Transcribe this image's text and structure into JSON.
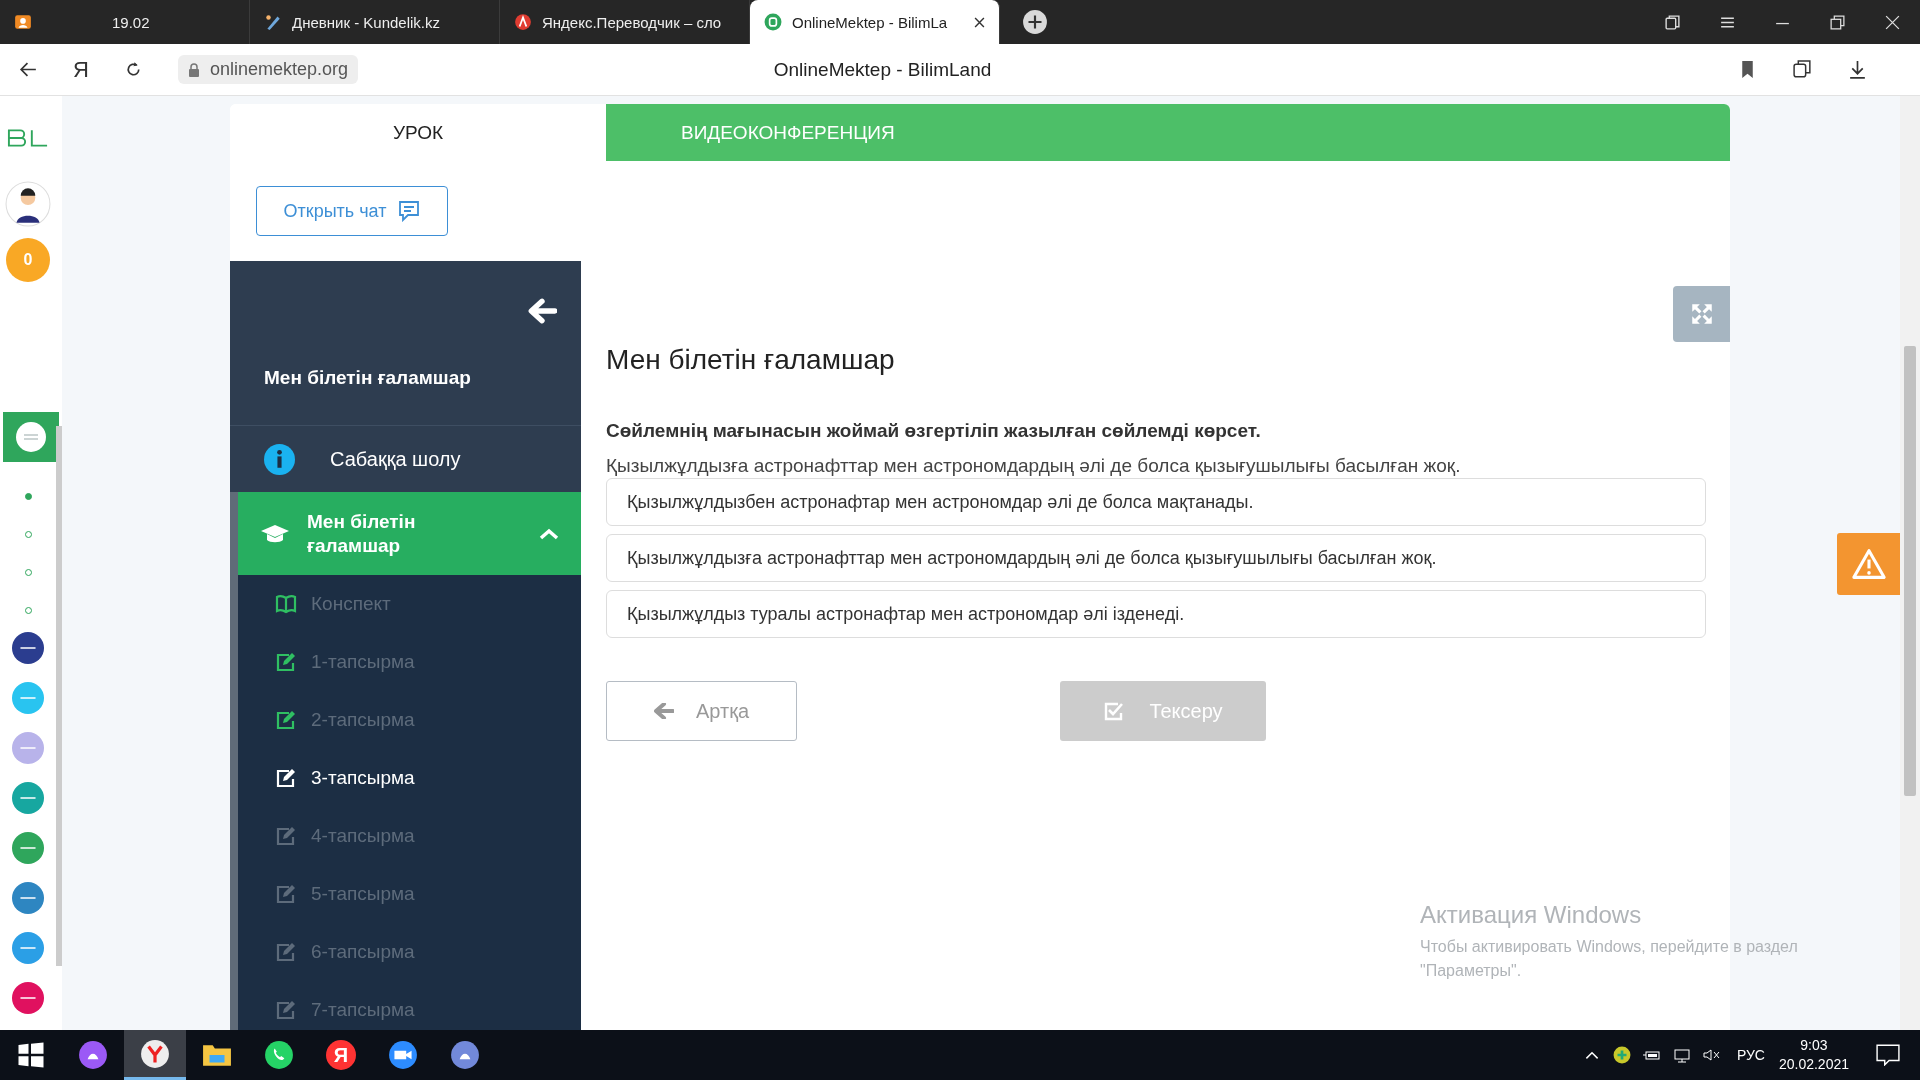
{
  "browser": {
    "tabs": [
      {
        "kind": "profile",
        "title": "19.02",
        "selected": false
      },
      {
        "kind": "diary",
        "title": "Дневник - Kundelik.kz",
        "selected": false
      },
      {
        "kind": "translate",
        "title": "Яндекс.Переводчик – сло",
        "selected": false
      },
      {
        "kind": "bilim",
        "title": "OnlineMektep - BilimLa",
        "selected": true
      }
    ],
    "yandex_key": "Я",
    "url": "onlinemektep.org",
    "page_title": "OnlineMektep - BilimLand"
  },
  "rail": {
    "coin": "0",
    "apps": [
      {
        "kind": "mektep",
        "selected": true
      }
    ],
    "dots": [
      {
        "selected": true
      },
      {
        "selected": false
      },
      {
        "selected": false
      },
      {
        "selected": false
      }
    ],
    "links": [
      {
        "kind": "smart"
      },
      {
        "kind": "help"
      },
      {
        "kind": "news"
      },
      {
        "kind": "online"
      },
      {
        "kind": "land"
      },
      {
        "kind": "book"
      },
      {
        "kind": "test"
      },
      {
        "kind": "twig"
      }
    ]
  },
  "lesson_tabs": [
    {
      "label": "УРОК",
      "selected": true
    },
    {
      "label": "ВИДЕОКОНФЕРЕНЦИЯ",
      "selected": false
    }
  ],
  "chat_button": "Открыть чат",
  "sidebar": {
    "title": "Мен білетін ғаламшар",
    "overview": "Сабаққа шолу",
    "section": {
      "title": "Мен білетін ғаламшар",
      "expanded": true,
      "items": [
        {
          "kind": "notes",
          "label": "Конспект",
          "done": true,
          "selected": false
        },
        {
          "kind": "task",
          "label": "1-тапсырма",
          "done": true,
          "selected": false
        },
        {
          "kind": "task",
          "label": "2-тапсырма",
          "done": true,
          "selected": false
        },
        {
          "kind": "task",
          "label": "3-тапсырма",
          "done": false,
          "selected": true
        },
        {
          "kind": "task",
          "label": "4-тапсырма",
          "done": false,
          "selected": false
        },
        {
          "kind": "task",
          "label": "5-тапсырма",
          "done": false,
          "selected": false
        },
        {
          "kind": "task",
          "label": "6-тапсырма",
          "done": false,
          "selected": false
        },
        {
          "kind": "task",
          "label": "7-тапсырма",
          "done": false,
          "selected": false
        }
      ]
    }
  },
  "content": {
    "title": "Мен білетін ғаламшар",
    "prompt": "Сөйлемнің мағынасын жоймай өзгертіліп жазылған сөйлемді көрсет.",
    "sentence": "Қызылжұлдызға астронафттар мен астрономдардың әлі де болса қызығушылығы басылған жоқ.",
    "options": [
      {
        "text": "Қызылжұлдызбен астронафтар мен астрономдар әлі де болса мақтанады.",
        "selected": false
      },
      {
        "text": "Қызылжұлдызға астронафттар мен астрономдардың әлі де болса қызығушылығы басылған жоқ.",
        "selected": false
      },
      {
        "text": "Қызылжұлдыз туралы астронафтар мен астрономдар әлі ізденеді.",
        "selected": false
      }
    ],
    "back_button": "Артқа",
    "check_button": {
      "label": "Тексеру",
      "disabled": true
    }
  },
  "windows_activation": {
    "title": "Активация Windows",
    "lines": [
      "Чтобы активировать Windows, перейдите в раздел",
      "\"Параметры\"."
    ]
  },
  "taskbar": {
    "apps": [
      {
        "kind": "start",
        "active": false
      },
      {
        "kind": "alice",
        "active": false
      },
      {
        "kind": "browser",
        "active": true
      },
      {
        "kind": "explorer",
        "active": false
      },
      {
        "kind": "whatsapp",
        "active": false
      },
      {
        "kind": "yandex",
        "active": false
      },
      {
        "kind": "zoom",
        "active": false
      },
      {
        "kind": "discord",
        "active": false
      }
    ],
    "yandex_letter": "Я",
    "language": "РУС",
    "time": "9:03",
    "date": "20.02.2021"
  }
}
